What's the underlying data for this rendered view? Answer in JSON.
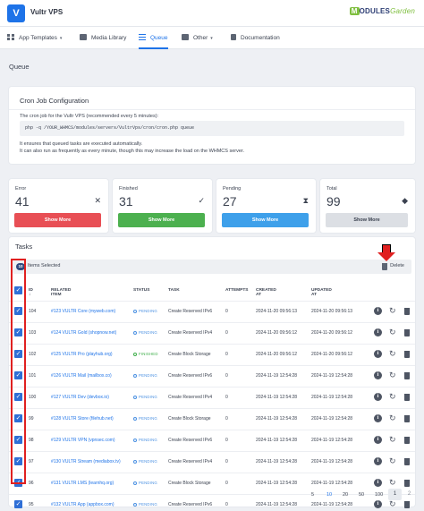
{
  "app": {
    "logo_glyph": "V",
    "title": "Vultr VPS",
    "brand": [
      "M",
      "ODULES",
      "Garden"
    ]
  },
  "nav": [
    {
      "label": "App Templates",
      "icon": "grid-icon",
      "caret": "▾"
    },
    {
      "label": "Media Library",
      "icon": "media-icon"
    },
    {
      "label": "Queue",
      "icon": "list-icon",
      "active": true
    },
    {
      "label": "Other",
      "icon": "box-icon",
      "caret": "▾"
    },
    {
      "label": "Documentation",
      "icon": "doc-icon"
    }
  ],
  "page_title": "Queue",
  "cron": {
    "heading": "Cron Job Configuration",
    "description": "The cron job for the Vultr VPS (recommended every 5 minutes):",
    "command": "php -q /YOUR_WHMCS/modules/servers/VultrVps/cron/cron.php queue",
    "note_1": "It ensures that queued tasks are executed automatically.",
    "note_2": "It can also run as frequently as every minute, though this may increase the load on the WHMCS server."
  },
  "stats": [
    {
      "label": "Error",
      "value": "41",
      "icon": "✕",
      "button": "Show More",
      "color": "#e84f55"
    },
    {
      "label": "Finished",
      "value": "31",
      "icon": "✓",
      "button": "Show More",
      "color": "#4cb04f"
    },
    {
      "label": "Pending",
      "value": "27",
      "icon": "⧗",
      "button": "Show More",
      "color": "#3ea0ea"
    },
    {
      "label": "Total",
      "value": "99",
      "icon": "◆",
      "button": "Show More",
      "color": "#dcdfe4"
    }
  ],
  "tasks": {
    "heading": "Tasks",
    "selected_count": "10",
    "selected_label": "Items Selected",
    "delete_label": "Delete",
    "columns": {
      "id": "ID",
      "id_sort": "↓",
      "related": "Related Item",
      "status": "Status",
      "task": "Task",
      "attempts": "Attempts",
      "created": "Created At",
      "updated": "Updated At"
    },
    "rows": [
      {
        "id": "104",
        "related": "#123 VULTR Core (myweb.com)",
        "status": "PENDING",
        "task": "Create Reserved IPv6",
        "attempts": "0",
        "created": "2024-11-20 09:56:13",
        "updated": "2024-11-20 09:56:13"
      },
      {
        "id": "103",
        "related": "#124 VULTR Gold (shopnow.net)",
        "status": "PENDING",
        "task": "Create Reserved IPv4",
        "attempts": "0",
        "created": "2024-11-20 09:56:12",
        "updated": "2024-11-20 09:56:12"
      },
      {
        "id": "102",
        "related": "#125 VULTR Pro (playhub.org)",
        "status": "FINISHED",
        "task": "Create Block Storage",
        "attempts": "0",
        "created": "2024-11-20 09:56:12",
        "updated": "2024-11-20 09:56:12"
      },
      {
        "id": "101",
        "related": "#126 VULTR Mail (mailbox.co)",
        "status": "PENDING",
        "task": "Create Reserved IPv6",
        "attempts": "0",
        "created": "2024-11-19 12:54:28",
        "updated": "2024-11-19 12:54:28"
      },
      {
        "id": "100",
        "related": "#127 VULTR Dev (devbox.io)",
        "status": "PENDING",
        "task": "Create Reserved IPv4",
        "attempts": "0",
        "created": "2024-11-19 12:54:28",
        "updated": "2024-11-19 12:54:28"
      },
      {
        "id": "99",
        "related": "#128 VULTR Store (filehub.net)",
        "status": "PENDING",
        "task": "Create Block Storage",
        "attempts": "0",
        "created": "2024-11-19 12:54:28",
        "updated": "2024-11-19 12:54:28"
      },
      {
        "id": "98",
        "related": "#129 VULTR VPN (vpnsec.com)",
        "status": "PENDING",
        "task": "Create Reserved IPv6",
        "attempts": "0",
        "created": "2024-11-19 12:54:28",
        "updated": "2024-11-19 12:54:28"
      },
      {
        "id": "97",
        "related": "#130 VULTR Stream (mediabox.tv)",
        "status": "PENDING",
        "task": "Create Reserved IPv4",
        "attempts": "0",
        "created": "2024-11-19 12:54:28",
        "updated": "2024-11-19 12:54:28"
      },
      {
        "id": "96",
        "related": "#131 VULTR LMS (learnhq.org)",
        "status": "PENDING",
        "task": "Create Block Storage",
        "attempts": "0",
        "created": "2024-11-19 12:54:28",
        "updated": "2024-11-19 12:54:28"
      },
      {
        "id": "95",
        "related": "#132 VULTR App (appbox.com)",
        "status": "PENDING",
        "task": "Create Reserved IPv6",
        "attempts": "0",
        "created": "2024-11-19 12:54:28",
        "updated": "2024-11-19 12:54:28"
      }
    ]
  },
  "pagination": {
    "sizes": [
      "5",
      "10",
      "20",
      "50",
      "100"
    ],
    "active_size": "10",
    "pages": [
      "1",
      "2"
    ],
    "current_page": "1",
    "next": "›",
    "last": "»"
  }
}
